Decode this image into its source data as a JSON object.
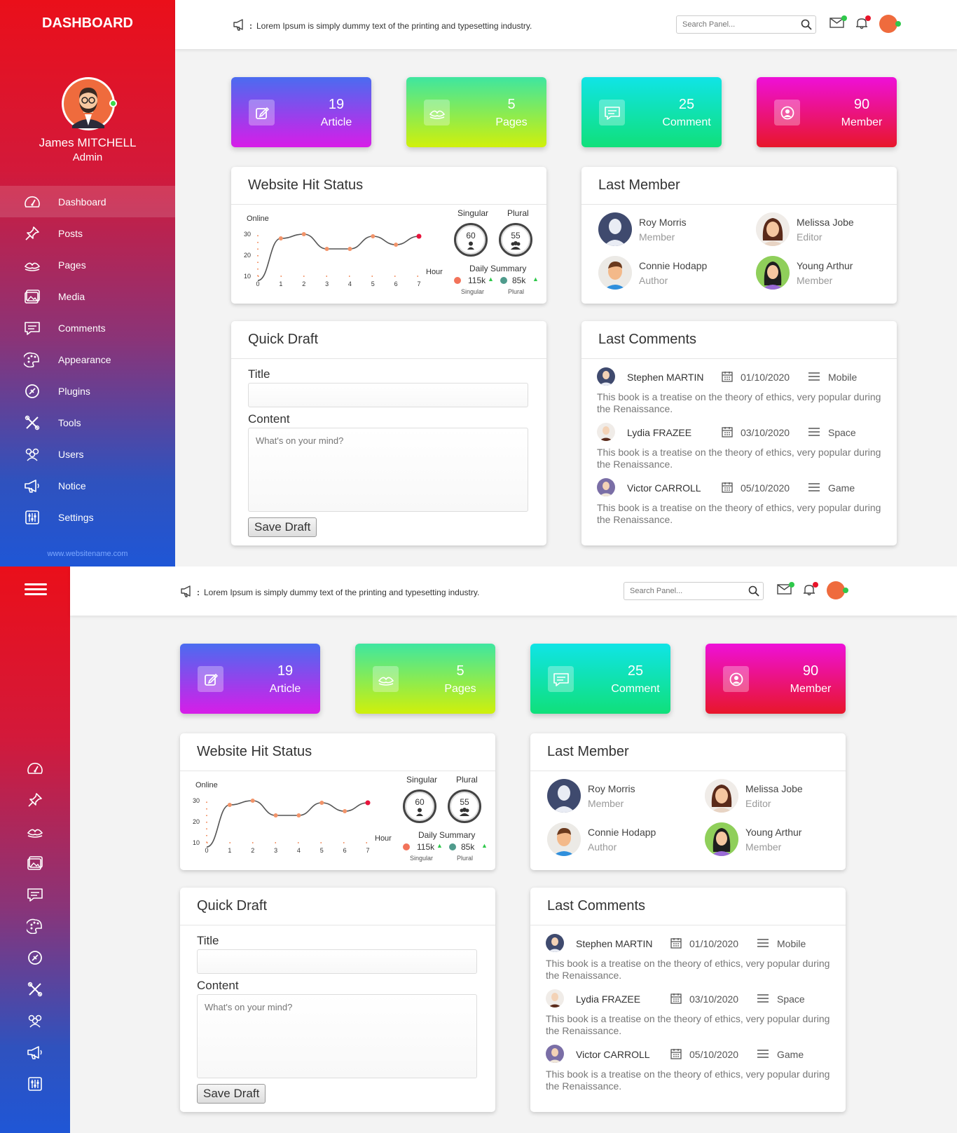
{
  "sidebar": {
    "brand": "DASHBOARD",
    "user_name": "James MITCHELL",
    "user_role": "Admin",
    "website": "www.websitename.com",
    "items": [
      {
        "label": "Dashboard",
        "icon": "speedometer-icon"
      },
      {
        "label": "Posts",
        "icon": "pin-icon"
      },
      {
        "label": "Pages",
        "icon": "pages-icon"
      },
      {
        "label": "Media",
        "icon": "media-icon"
      },
      {
        "label": "Comments",
        "icon": "comment-icon"
      },
      {
        "label": "Appearance",
        "icon": "palette-icon"
      },
      {
        "label": "Plugins",
        "icon": "plugin-icon"
      },
      {
        "label": "Tools",
        "icon": "tools-icon"
      },
      {
        "label": "Users",
        "icon": "users-icon"
      },
      {
        "label": "Notice",
        "icon": "megaphone-icon"
      },
      {
        "label": "Settings",
        "icon": "settings-icon"
      }
    ]
  },
  "topbar": {
    "notice": "Lorem Ipsum is simply dummy text of the printing and typesetting industry.",
    "search_placeholder": "Search Panel..."
  },
  "stats": [
    {
      "value": "19",
      "label": "Article",
      "icon": "edit-icon"
    },
    {
      "value": "5",
      "label": "Pages",
      "icon": "pages-icon"
    },
    {
      "value": "25",
      "label": "Comment",
      "icon": "comment-icon"
    },
    {
      "value": "90",
      "label": "Member",
      "icon": "user-icon"
    }
  ],
  "hit_status": {
    "title": "Website Hit Status",
    "singular_label": "Singular",
    "plural_label": "Plural",
    "singular_value": "60",
    "plural_value": "55",
    "summary_title": "Daily Summary",
    "singular_total": "115k",
    "plural_total": "85k",
    "singular_small": "Singular",
    "plural_small": "Plural"
  },
  "chart_data": {
    "type": "line",
    "ylabel": "Online",
    "xlabel": "Hour",
    "x": [
      0,
      1,
      2,
      3,
      4,
      5,
      6,
      7
    ],
    "values": [
      8,
      28,
      30,
      23,
      23,
      29,
      25,
      29
    ],
    "xticks": [
      "0",
      "1",
      "2",
      "3",
      "4",
      "5",
      "6",
      "7"
    ],
    "yticks": [
      "10",
      "20",
      "30"
    ],
    "ylim": [
      10,
      30
    ],
    "xlim": [
      0,
      7
    ]
  },
  "last_member": {
    "title": "Last Member",
    "members": [
      {
        "name": "Roy Morris",
        "role": "Member"
      },
      {
        "name": "Melissa Jobe",
        "role": "Editor"
      },
      {
        "name": "Connie Hodapp",
        "role": "Author"
      },
      {
        "name": "Young Arthur",
        "role": "Member"
      }
    ]
  },
  "quick_draft": {
    "title": "Quick Draft",
    "title_label": "Title",
    "title_value": "",
    "content_label": "Content",
    "content_placeholder": "What's on your mind?",
    "save_label": "Save Draft"
  },
  "last_comments": {
    "title": "Last Comments",
    "comments": [
      {
        "name": "Stephen MARTIN",
        "date": "01/10/2020",
        "category": "Mobile",
        "text": "This book is a treatise on the theory of ethics, very popular during the Renaissance."
      },
      {
        "name": "Lydia FRAZEE",
        "date": "03/10/2020",
        "category": "Space",
        "text": "This book is a treatise on the theory of ethics, very popular during the Renaissance."
      },
      {
        "name": "Victor CARROLL",
        "date": "05/10/2020",
        "category": "Game",
        "text": "This book is a treatise on the theory of ethics, very popular during the Renaissance."
      }
    ]
  },
  "colors": {
    "stat_gradients": [
      [
        "#4a6cf0",
        "#d71de8"
      ],
      [
        "#3ee6a0",
        "#d0f00a"
      ],
      [
        "#10e4e6",
        "#10e07a"
      ],
      [
        "#ee10d8",
        "#e8162a"
      ]
    ],
    "chart_line": "#555555",
    "chart_point": "#f2946a",
    "chart_last_point": "#e8143c"
  }
}
